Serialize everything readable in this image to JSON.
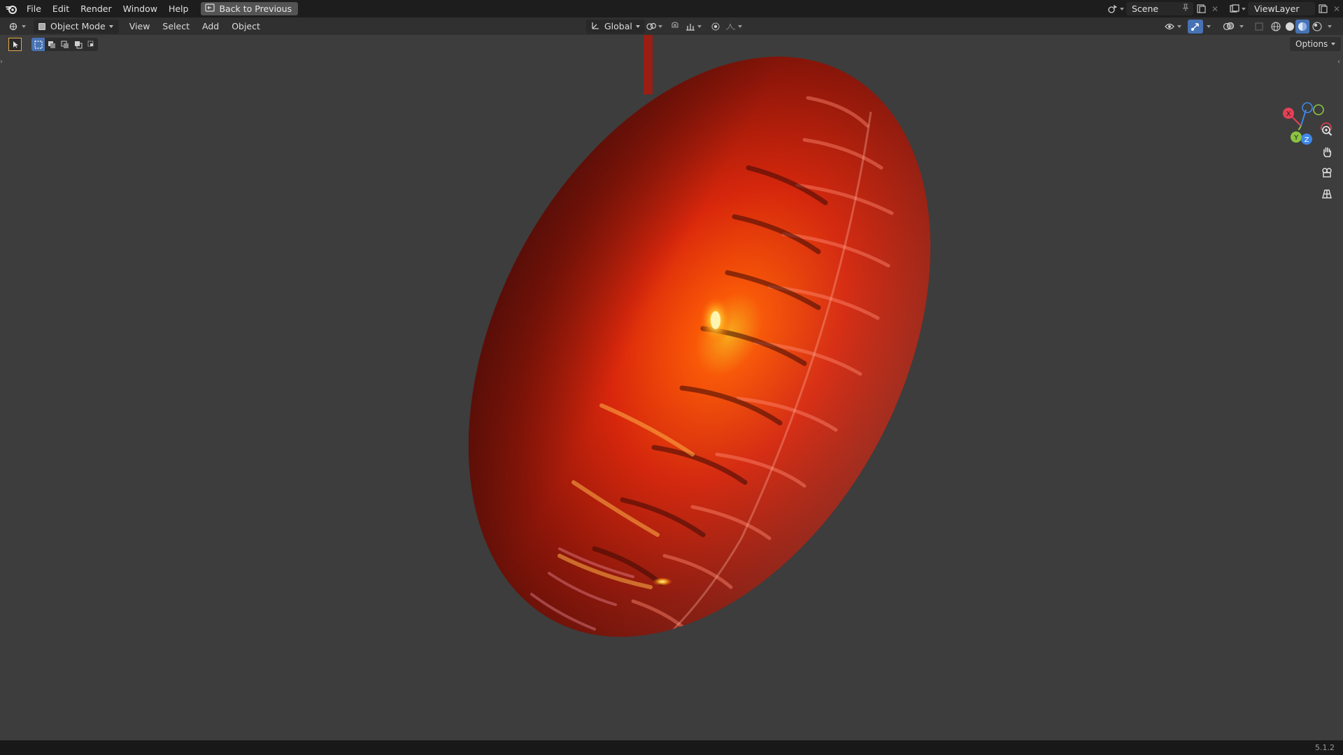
{
  "menu": {
    "items": [
      "File",
      "Edit",
      "Render",
      "Window",
      "Help"
    ],
    "back_button": "Back to Previous"
  },
  "workspace": {
    "scene": "Scene",
    "view_layer": "ViewLayer"
  },
  "viewport_header": {
    "mode": "Object Mode",
    "menus": [
      "View",
      "Select",
      "Add",
      "Object"
    ],
    "orientation": "Global"
  },
  "viewport": {
    "options_label": "Options",
    "gizmo": {
      "x_label": "X",
      "y_label": "Y",
      "z_label": "Z"
    }
  },
  "status": {
    "version": "5.1.2"
  },
  "colors": {
    "accent": "#4772b3",
    "gizmo_x": "#e54056",
    "gizmo_y": "#8bc43f",
    "gizmo_z": "#3d87e8",
    "object_red": "#d9270c"
  }
}
